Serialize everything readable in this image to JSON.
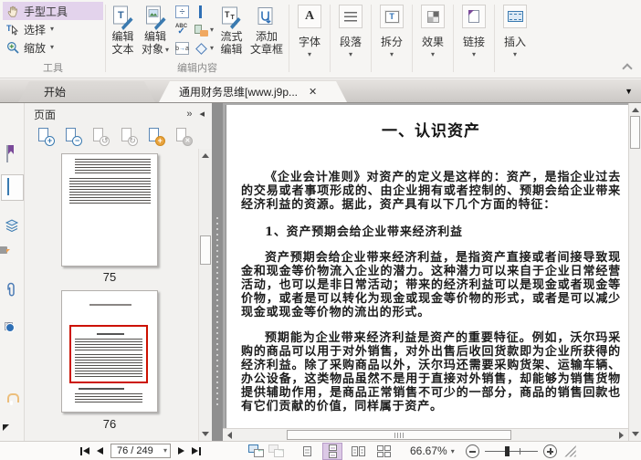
{
  "colors": {
    "selection_lavender": "#e3d3ec",
    "icon_blue": "#3a7ab0",
    "thumbnail_highlight_red": "#cc1100",
    "accent_orange": "#e8a33d",
    "splitter_gray": "#8f8f8f"
  },
  "ribbon": {
    "tools": {
      "group_label": "工具",
      "hand_tool": "手型工具",
      "select": "选择",
      "zoom": "缩放"
    },
    "edit": {
      "group_label": "编辑内容",
      "edit_text_l1": "编辑",
      "edit_text_l2": "文本",
      "edit_object_l1": "编辑",
      "edit_object_l2": "对象",
      "flow_edit_l1": "流式",
      "flow_edit_l2": "编辑",
      "add_article_l1": "添加",
      "add_article_l2": "文章框"
    },
    "format": {
      "font": "字体",
      "paragraph": "段落",
      "split": "拆分",
      "effect": "效果",
      "link": "链接",
      "insert": "插入"
    }
  },
  "tabs": {
    "start": "开始",
    "document": "通用财务思维[www.j9p..."
  },
  "pages_panel": {
    "title": "页面",
    "thumb_75_label": "75",
    "thumb_76_label": "76"
  },
  "document": {
    "title": "一、认识资产",
    "para_1": "《企业会计准则》对资产的定义是这样的：资产，是指企业过去的交易或者事项形成的、由企业拥有或者控制的、预期会给企业带来经济利益的资源。据此，资产具有以下几个方面的特征：",
    "heading_1": "1、资产预期会给企业带来经济利益",
    "para_2": "资产预期会给企业带来经济利益，是指资产直接或者间接导致现金和现金等价物流入企业的潜力。这种潜力可以来自于企业日常经营活动，也可以是非日常活动；带来的经济利益可以是现金或者现金等价物，或者是可以转化为现金或现金等价物的形式，或者是可以减少现金或现金等价物的流出的形式。",
    "para_3": "预期能为企业带来经济利益是资产的重要特征。例如，沃尔玛采购的商品可以用于对外销售，对外出售后收回货款即为企业所获得的经济利益。除了采购商品以外，沃尔玛还需要采购货架、运输车辆、办公设备，这类物品虽然不是用于直接对外销售，却能够为销售货物提供辅助作用，是商品正常销售不可少的一部分，商品的销售回款也有它们贡献的价值，同样属于资产。"
  },
  "status_bar": {
    "page_indicator": "76 / 249",
    "zoom_level": "66.67%"
  },
  "icons": {
    "caret_down": "▾",
    "menu_down": "▼",
    "close": "✕",
    "collapse_all": "»",
    "collapse_panel": "◂",
    "divide": "÷",
    "spell_abc": "ABC",
    "spell_check": "✓",
    "sub_b": "b",
    "sub_a": "a",
    "to_arrow": "→",
    "letter_T": "T",
    "letter_A": "A",
    "plus": "+",
    "minus": "−",
    "rotate_left": "↺",
    "rotate_right": "↻",
    "back_arrow": "←",
    "forward_arrow": "→",
    "at_sign": "@"
  }
}
